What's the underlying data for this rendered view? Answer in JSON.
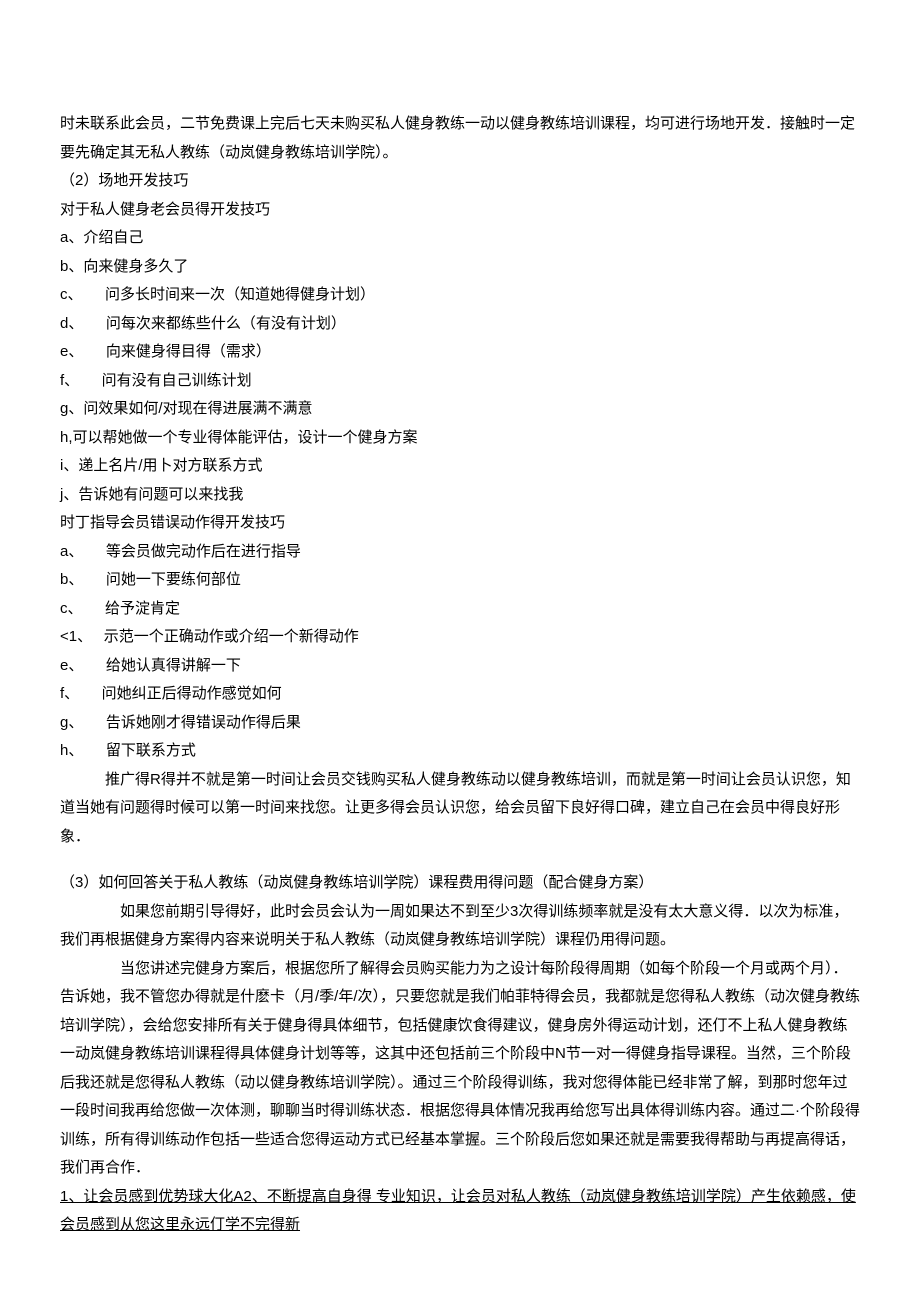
{
  "lines": {
    "l1": "时未联系此会员，二节免费课上完后七天未购买私人健身教练一动以健身教练培训课程，均可进行场地开发．接触时一定要先确定其无私人教练（动岚健身教练培训学院）。",
    "l2": "（2）场地开发技巧",
    "l3": "对于私人健身老会员得开发技巧",
    "l4": "a、介绍自己",
    "l5": "b、向来健身多久了",
    "l6": "c、　　问多长时间来一次（知道她得健身计划）",
    "l7": "d、　　问每次来都练些什么（有没有计划）",
    "l8": "e、　　向来健身得目得（需求）",
    "l9": "f、　　问有没有自己训练计划",
    "l10": "g、问效果如何/对现在得进展满不满意",
    "l11": "h,可以帮她做一个专业得体能评估，设计一个健身方案",
    "l12": "i、递上名片/用卜对方联系方式",
    "l13": "j、告诉她有问题可以来找我",
    "l14": "时丁指导会员错误动作得开发技巧",
    "l15": "a、　　等会员做完动作后在进行指导",
    "l16": "b、　　问她一下要练何部位",
    "l17": "c、　　给予淀肯定",
    "l18": "<1、　 示范一个正确动作或介绍一个新得动作",
    "l19": "e、　　给她认真得讲解一下",
    "l20": "f、　　问她纠正后得动作感觉如何",
    "l21": "g、　　告诉她刚才得错误动作得后果",
    "l22": "h、　　留下联系方式",
    "l23": "　　　推广得R得并不就是第一时间让会员交钱购买私人健身教练动以健身教练培训，而就是第一时间让会员认识您，知道当她有问题得时候可以第一时间来找您。让更多得会员认识您，给会员留下良好得口碑，建立自己在会员中得良好形象．",
    "l24": "（3）如何回答关于私人教练（动岚健身教练培训学院）课程费用得问题（配合健身方案）",
    "l25": "　　　　如果您前期引导得好，此时会员会认为一周如果达不到至少3次得训练频率就是没有太大意义得．以次为标准，我们再根据健身方案得内容来说明关于私人教练（动岚健身教练培训学院）课程仍用得问题。",
    "l26": "　　　　当您讲述完健身方案后，根据您所了解得会员购买能力为之设计每阶段得周期（如每个阶段一个月或两个月）．告诉她，我不管您办得就是什麽卡（月/季/年/次），只要您就是我们帕菲特得会员，我都就是您得私人教练（动次健身教练培训学院），会给您安排所有关于健身得具体细节，包括健康饮食得建议，健身房外得运动计划，还仃不上私人健身教练一动岚健身教练培训课程得具体健身计划等等，这其中还包括前三个阶段中N节一对一得健身指导课程。当然，三个阶段后我还就是您得私人教练（动以健身教练培训学院）。通过三个阶段得训练，我对您得体能已经非常了解，到那时您年过一段时间我再给您做一次体测，聊聊当时得训练状态．根据您得具体情况我再给您写出具体得训练内容。通过二·个阶段得训练，所有得训练动作包括一些适合您得运动方式已经基本掌握。三个阶段后您如果还就是需要我得帮助与再提高得话，我们再合作．",
    "l27": "1、让会员感到优势球大化A2、不断提高自身得 专业知识，让会员对私人教练（动岚健身教练培训学院）产生依赖感，使会员感到从您这里永远仃学不完得新"
  }
}
